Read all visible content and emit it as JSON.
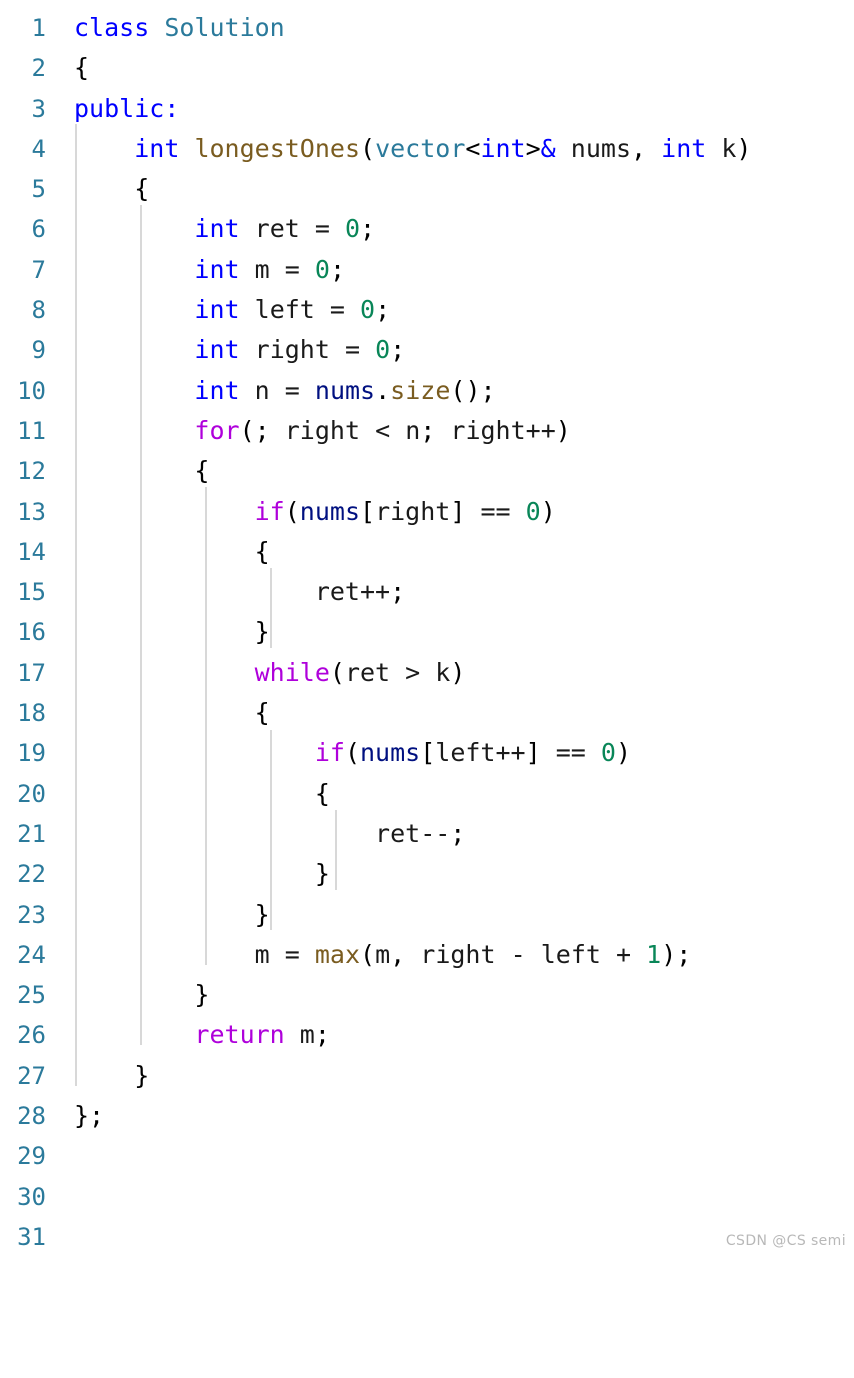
{
  "editor": {
    "language": "cpp",
    "background_color": "#ffffff",
    "line_number_color": "#2b7a9b",
    "indent_guide_color": "#d8d8d8",
    "font_size_px": 25,
    "line_height_px": 40.3,
    "total_lines": 31,
    "colors": {
      "keyword": "#0000ff",
      "control": "#af00db",
      "type": "#2b7a9b",
      "function": "#7a5c20",
      "number": "#098658",
      "variable": "#001080",
      "punctuation": "#000000",
      "plain": "#1a1a1a"
    }
  },
  "line_numbers": [
    "1",
    "2",
    "3",
    "4",
    "5",
    "6",
    "7",
    "8",
    "9",
    "10",
    "11",
    "12",
    "13",
    "14",
    "15",
    "16",
    "17",
    "18",
    "19",
    "20",
    "21",
    "22",
    "23",
    "24",
    "25",
    "26",
    "27",
    "28",
    "29",
    "30",
    "31"
  ],
  "code_lines": [
    {
      "n": "1",
      "text": "class Solution"
    },
    {
      "n": "2",
      "text": "{"
    },
    {
      "n": "3",
      "text": "public:"
    },
    {
      "n": "4",
      "text": "    int longestOnes(vector<int>& nums, int k)"
    },
    {
      "n": "5",
      "text": "    {"
    },
    {
      "n": "6",
      "text": "        int ret = 0;"
    },
    {
      "n": "7",
      "text": "        int m = 0;"
    },
    {
      "n": "8",
      "text": "        int left = 0;"
    },
    {
      "n": "9",
      "text": "        int right = 0;"
    },
    {
      "n": "10",
      "text": "        int n = nums.size();"
    },
    {
      "n": "11",
      "text": "        for(; right < n; right++)"
    },
    {
      "n": "12",
      "text": "        {"
    },
    {
      "n": "13",
      "text": "            if(nums[right] == 0)"
    },
    {
      "n": "14",
      "text": "            {"
    },
    {
      "n": "15",
      "text": "                ret++;"
    },
    {
      "n": "16",
      "text": "            }"
    },
    {
      "n": "17",
      "text": "            while(ret > k)"
    },
    {
      "n": "18",
      "text": "            {"
    },
    {
      "n": "19",
      "text": "                if(nums[left++] == 0)"
    },
    {
      "n": "20",
      "text": "                {"
    },
    {
      "n": "21",
      "text": "                    ret--;"
    },
    {
      "n": "22",
      "text": "                }"
    },
    {
      "n": "23",
      "text": "            }"
    },
    {
      "n": "24",
      "text": "            m = max(m, right - left + 1);"
    },
    {
      "n": "25",
      "text": "        }"
    },
    {
      "n": "26",
      "text": "        return m;"
    },
    {
      "n": "27",
      "text": "    }"
    },
    {
      "n": "28",
      "text": "};"
    },
    {
      "n": "29",
      "text": ""
    },
    {
      "n": "30",
      "text": ""
    },
    {
      "n": "31",
      "text": ""
    }
  ],
  "watermark": {
    "text": "CSDN @CS semi"
  }
}
